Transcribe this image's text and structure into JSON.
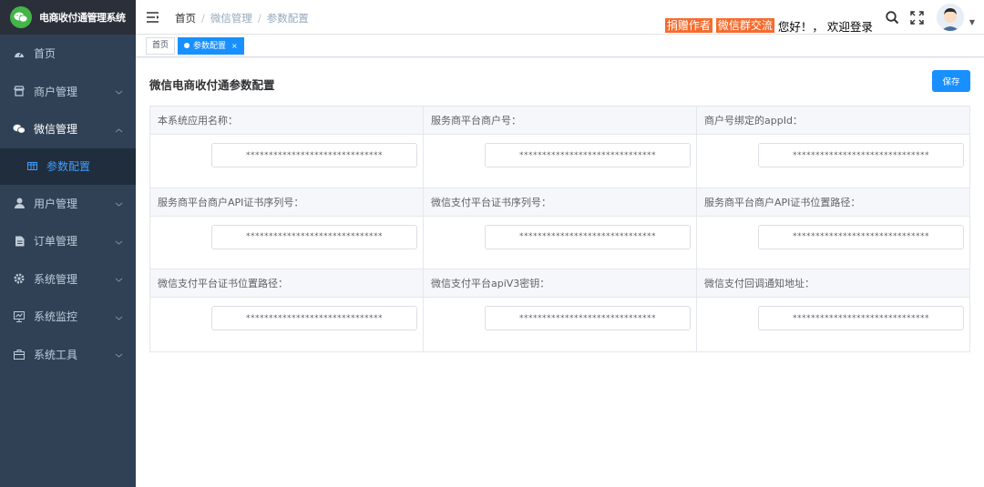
{
  "app": {
    "title": "电商收付通管理系统"
  },
  "sidebar": {
    "items": [
      {
        "label": "首页",
        "icon": "dashboard-icon"
      },
      {
        "label": "商户管理",
        "icon": "merchant-icon"
      },
      {
        "label": "微信管理",
        "icon": "wechat-icon",
        "expanded": true
      },
      {
        "label": "参数配置",
        "icon": "table-icon",
        "active": true
      },
      {
        "label": "用户管理",
        "icon": "user-icon"
      },
      {
        "label": "订单管理",
        "icon": "order-icon"
      },
      {
        "label": "系统管理",
        "icon": "gear-icon"
      },
      {
        "label": "系统监控",
        "icon": "monitor-icon"
      },
      {
        "label": "系统工具",
        "icon": "toolbox-icon"
      }
    ]
  },
  "navbar": {
    "breadcrumb": [
      "首页",
      "微信管理",
      "参数配置"
    ],
    "tags": [
      "捐赠作者",
      "微信群交流"
    ],
    "greeting": "您好！， 欢迎登录",
    "tag_color": "#f56c2d"
  },
  "tagsview": {
    "tabs": [
      {
        "label": "首页"
      },
      {
        "label": "参数配置",
        "active": true
      }
    ]
  },
  "main": {
    "title": "微信电商收付通参数配置",
    "save_label": "保存",
    "accent": "#1890ff",
    "fields": [
      {
        "label": "本系统应用名称：",
        "value": "******************************"
      },
      {
        "label": "服务商平台商户号：",
        "value": "******************************"
      },
      {
        "label": "商户号绑定的appId：",
        "value": "******************************"
      },
      {
        "label": "服务商平台商户API证书序列号：",
        "value": "******************************"
      },
      {
        "label": "微信支付平台证书序列号：",
        "value": "******************************"
      },
      {
        "label": "服务商平台商户API证书位置路径：",
        "value": "******************************"
      },
      {
        "label": "微信支付平台证书位置路径：",
        "value": "******************************"
      },
      {
        "label": "微信支付平台apiV3密钥：",
        "value": "******************************"
      },
      {
        "label": "微信支付回调通知地址：",
        "value": "******************************"
      }
    ]
  }
}
